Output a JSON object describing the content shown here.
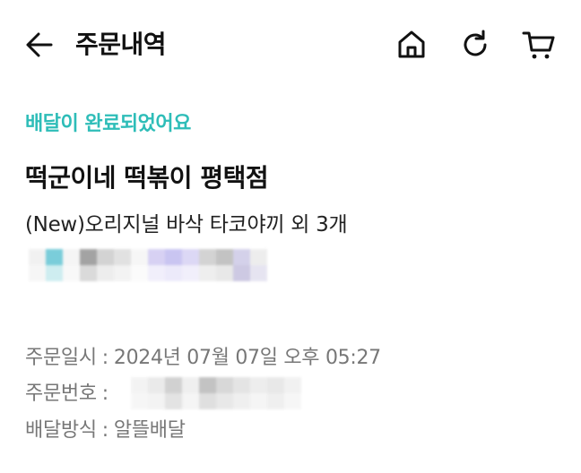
{
  "header": {
    "title": "주문내역",
    "icons": [
      "back-arrow-icon",
      "home-icon",
      "refresh-icon",
      "cart-icon"
    ]
  },
  "order": {
    "status": "배달이 완료되었어요",
    "store_name": "떡군이네 떡볶이 평택점",
    "items_summary": "(New)오리지널 바삭 타코야끼 외 3개",
    "details": {
      "date_label": "주문일시",
      "date_value": "2024년 07월 07일 오후 05:27",
      "number_label": "주문번호",
      "method_label": "배달방식",
      "method_value": "알뜰배달",
      "separator": ":"
    }
  },
  "colors": {
    "status_accent": "#2ebdb8",
    "text_primary": "#111111",
    "text_secondary": "#777777"
  }
}
